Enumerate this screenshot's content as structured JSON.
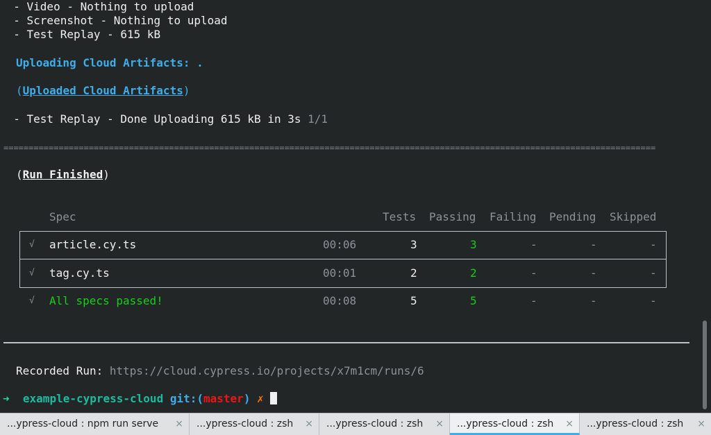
{
  "upload_lines": [
    "  - Video - Nothing to upload",
    "  - Screenshot - Nothing to upload",
    "  - Test Replay - 615 kB"
  ],
  "uploading_label": "Uploading Cloud Artifacts: .",
  "uploaded_label": "Uploaded Cloud Artifacts",
  "replay_done": "  - Test Replay - Done Uploading 615 kB in 3s ",
  "replay_count": "1/1",
  "separator": "==================================================================================================================================",
  "run_finished": "Run Finished",
  "table": {
    "headers": {
      "spec": "Spec",
      "tests": "Tests",
      "passing": "Passing",
      "failing": "Failing",
      "pending": "Pending",
      "skipped": "Skipped"
    },
    "rows": [
      {
        "mark": "√",
        "spec": "article.cy.ts",
        "time": "00:06",
        "tests": "3",
        "passing": "3",
        "failing": "-",
        "pending": "-",
        "skipped": "-"
      },
      {
        "mark": "√",
        "spec": "tag.cy.ts",
        "time": "00:01",
        "tests": "2",
        "passing": "2",
        "failing": "-",
        "pending": "-",
        "skipped": "-"
      }
    ],
    "summary": {
      "mark": "√",
      "spec": "All specs passed!",
      "time": "00:08",
      "tests": "5",
      "passing": "5",
      "failing": "-",
      "pending": "-",
      "skipped": "-"
    }
  },
  "recorded_run_label": "Recorded Run: ",
  "recorded_run_url": "https://cloud.cypress.io/projects/x7m1cm/runs/6",
  "prompt": {
    "arrow": "➜",
    "dir": "example-cypress-cloud",
    "git_label": "git:(",
    "branch": "master",
    "git_close": ")",
    "dirty": "✗"
  },
  "tabs": [
    {
      "label": "...ypress-cloud : npm run serve",
      "active": false
    },
    {
      "label": "...ypress-cloud : zsh",
      "active": false
    },
    {
      "label": "...ypress-cloud : zsh",
      "active": false
    },
    {
      "label": "...ypress-cloud : zsh",
      "active": true
    },
    {
      "label": "...ypress-cloud : zsh",
      "active": false
    }
  ],
  "close_glyph": "×"
}
